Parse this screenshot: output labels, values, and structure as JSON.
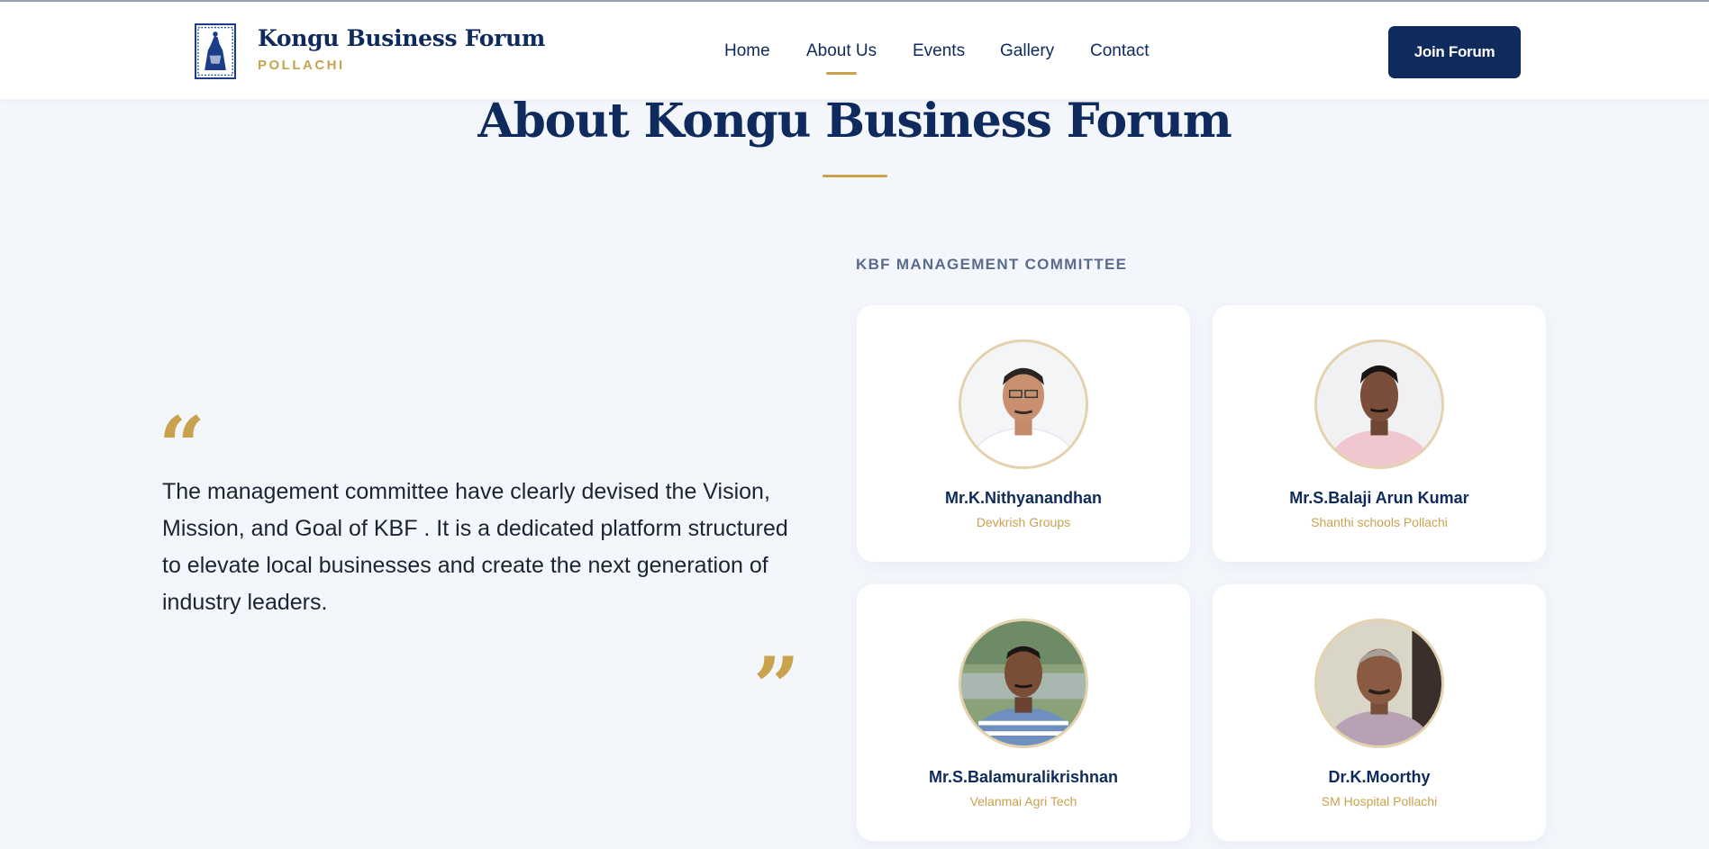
{
  "header": {
    "brand_name": "Kongu Business Forum",
    "brand_sub": "POLLACHI",
    "nav": [
      {
        "label": "Home",
        "active": false
      },
      {
        "label": "About Us",
        "active": true
      },
      {
        "label": "Events",
        "active": false
      },
      {
        "label": "Gallery",
        "active": false
      },
      {
        "label": "Contact",
        "active": false
      }
    ],
    "join_label": "Join Forum"
  },
  "main": {
    "title": "About Kongu Business Forum",
    "quote_open": "“",
    "quote_close": "”",
    "quote_text": "The management committee have clearly devised the Vision, Mission, and Goal of KBF . It is a dedicated platform structured to elevate local businesses and create the next generation of industry leaders."
  },
  "committee": {
    "heading": "KBF MANAGEMENT COMMITTEE",
    "members": [
      {
        "name": "Mr.K.Nithyanandhan",
        "org": "Devkrish Groups"
      },
      {
        "name": "Mr.S.Balaji Arun Kumar",
        "org": "Shanthi schools Pollachi"
      },
      {
        "name": "Mr.S.Balamuralikrishnan",
        "org": "Velanmai Agri Tech"
      },
      {
        "name": "Dr.K.Moorthy",
        "org": "SM Hospital Pollachi"
      }
    ]
  },
  "colors": {
    "navy": "#0f2a5c",
    "gold": "#c9a24d",
    "background": "#f3f7fc"
  }
}
